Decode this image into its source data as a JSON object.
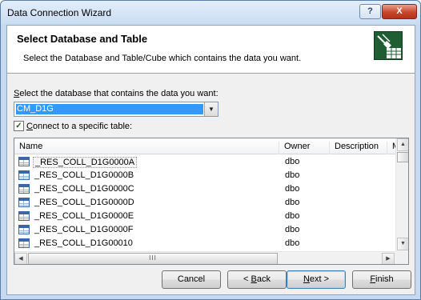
{
  "window": {
    "title": "Data Connection Wizard",
    "help_label": "?",
    "close_label": "X"
  },
  "header": {
    "title": "Select Database and Table",
    "subtitle": "Select the Database and Table/Cube which contains the data you want.",
    "icon": "data-connection-icon"
  },
  "database": {
    "label_accel": "S",
    "label_rest": "elect the database that contains the data you want:",
    "selected": "CM_D1G",
    "dropdown_icon": "▼"
  },
  "connect_table": {
    "checked": true,
    "check_mark": "✓",
    "label_accel": "C",
    "label_rest": "onnect to a specific table:"
  },
  "table_list": {
    "columns": [
      "Name",
      "Owner",
      "Description",
      "Mo"
    ],
    "rows": [
      {
        "name": "_RES_COLL_D1G0000A",
        "owner": "dbo"
      },
      {
        "name": "_RES_COLL_D1G0000B",
        "owner": "dbo"
      },
      {
        "name": "_RES_COLL_D1G0000C",
        "owner": "dbo"
      },
      {
        "name": "_RES_COLL_D1G0000D",
        "owner": "dbo"
      },
      {
        "name": "_RES_COLL_D1G0000E",
        "owner": "dbo"
      },
      {
        "name": "_RES_COLL_D1G0000F",
        "owner": "dbo"
      },
      {
        "name": "_RES_COLL_D1G00010",
        "owner": "dbo"
      }
    ],
    "scroll_up": "▲",
    "scroll_down": "▼",
    "scroll_left": "◀",
    "scroll_right": "▶",
    "thumb_grip": "III"
  },
  "buttons": {
    "cancel": "Cancel",
    "back_prefix": "< ",
    "back_accel": "B",
    "back_rest": "ack",
    "next_accel": "N",
    "next_rest": "ext >",
    "finish_accel": "F",
    "finish_rest": "inish"
  }
}
